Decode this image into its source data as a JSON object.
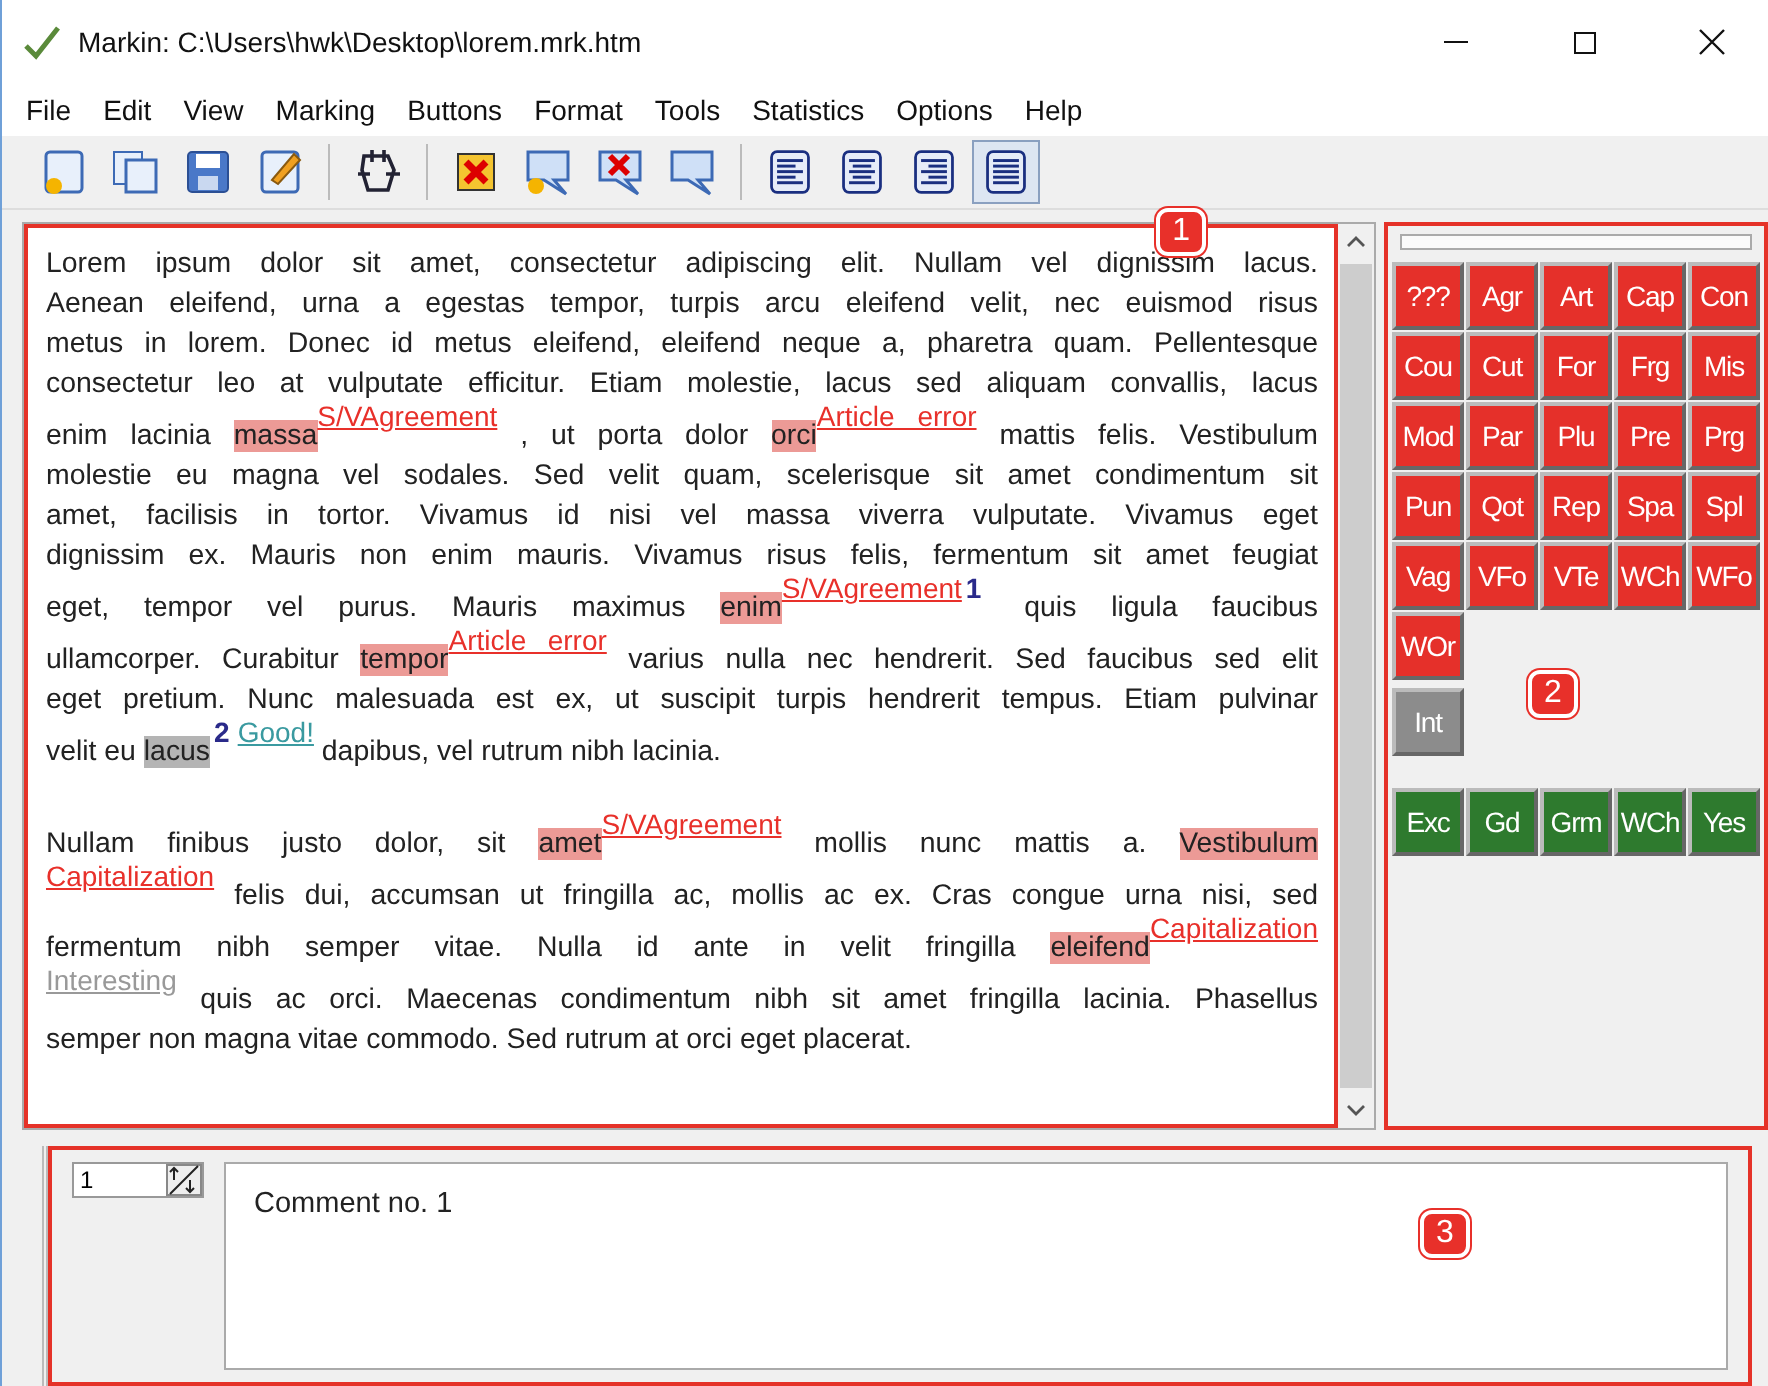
{
  "window": {
    "title": "Markin: C:\\Users\\hwk\\Desktop\\lorem.mrk.htm"
  },
  "menu": [
    "File",
    "Edit",
    "View",
    "Marking",
    "Buttons",
    "Format",
    "Tools",
    "Statistics",
    "Options",
    "Help"
  ],
  "alignment": [
    {
      "kind": "left",
      "selected": false
    },
    {
      "kind": "center",
      "selected": false
    },
    {
      "kind": "right",
      "selected": false
    },
    {
      "kind": "justify",
      "selected": true
    }
  ],
  "document": {
    "callout": "1",
    "paragraphs": [
      [
        [
          {
            "kind": "text",
            "text": "Lorem ipsum dolor sit amet, consectetur adipiscing elit. Nullam vel dignissim lacus."
          }
        ],
        [
          {
            "kind": "text",
            "text": "Aenean eleifend, urna a egestas tempor, turpis arcu eleifend velit, nec euismod risus"
          }
        ],
        [
          {
            "kind": "text",
            "text": "metus in lorem. Donec id metus eleifend, eleifend neque a, pharetra quam. Pellentesque"
          }
        ],
        [
          {
            "kind": "text",
            "text": "consectetur leo at vulputate efficitur. Etiam molestie, lacus sed aliquam convallis, lacus"
          }
        ],
        [
          {
            "kind": "text",
            "text": "enim lacinia "
          },
          {
            "kind": "word",
            "text": "massa",
            "color": "#ec9a96"
          },
          {
            "kind": "label",
            "text": "S/VAgreement",
            "color": "#e8302a"
          },
          {
            "kind": "text",
            "text": " , ut porta dolor "
          },
          {
            "kind": "word",
            "text": "orci",
            "color": "#ec9a96"
          },
          {
            "kind": "label",
            "text": "Article error",
            "color": "#e8302a"
          },
          {
            "kind": "text",
            "text": " mattis felis. Vestibulum"
          }
        ],
        [
          {
            "kind": "text",
            "text": "molestie eu magna vel sodales. Sed velit quam, scelerisque sit amet condimentum sit"
          }
        ],
        [
          {
            "kind": "text",
            "text": "amet, facilisis in tortor. Vivamus id nisi vel massa viverra vulputate. Vivamus eget"
          }
        ],
        [
          {
            "kind": "text",
            "text": "dignissim ex. Mauris non enim mauris. Vivamus risus felis, fermentum sit amet feugiat"
          }
        ],
        [
          {
            "kind": "text",
            "text": "eget, tempor vel purus. Mauris maximus "
          },
          {
            "kind": "word",
            "text": "enim",
            "color": "#ec9a96"
          },
          {
            "kind": "label",
            "text": "S/VAgreement",
            "color": "#e8302a"
          },
          {
            "kind": "number",
            "text": "1"
          },
          {
            "kind": "text",
            "text": " quis ligula faucibus"
          }
        ],
        [
          {
            "kind": "text",
            "text": "ullamcorper. Curabitur "
          },
          {
            "kind": "word",
            "text": "tempor",
            "color": "#ec9a96"
          },
          {
            "kind": "label",
            "text": "Article error",
            "color": "#e8302a"
          },
          {
            "kind": "text",
            "text": " varius nulla nec hendrerit. Sed faucibus sed elit"
          }
        ],
        [
          {
            "kind": "text",
            "text": "eget pretium. Nunc malesuada est ex, ut suscipit turpis hendrerit tempus. Etiam pulvinar"
          }
        ],
        [
          {
            "kind": "text",
            "text": "velit eu "
          },
          {
            "kind": "word",
            "text": "lacus",
            "color": "#b4b4b4"
          },
          {
            "kind": "number",
            "text": "2"
          },
          {
            "kind": "label",
            "text": "Good!",
            "color": "#3a9aa0"
          },
          {
            "kind": "text",
            "text": " dapibus, vel rutrum nibh lacinia."
          }
        ]
      ],
      [
        [
          {
            "kind": "text",
            "text": "Nullam finibus justo dolor, sit "
          },
          {
            "kind": "word",
            "text": "amet",
            "color": "#ec9a96"
          },
          {
            "kind": "label",
            "text": "S/VAgreement",
            "color": "#e8302a"
          },
          {
            "kind": "text",
            "text": " mollis nunc mattis a. "
          },
          {
            "kind": "word",
            "text": "Vestibulum",
            "color": "#ec9a96"
          }
        ],
        [
          {
            "kind": "label",
            "text": "Capitalization",
            "color": "#e8302a"
          },
          {
            "kind": "text",
            "text": " felis dui, accumsan ut fringilla ac, mollis ac ex. Cras congue urna nisi, sed"
          }
        ],
        [
          {
            "kind": "text",
            "text": "fermentum nibh semper vitae. Nulla id ante in velit fringilla "
          },
          {
            "kind": "word",
            "text": "eleifend",
            "color": "#ec9a96"
          },
          {
            "kind": "label",
            "text": "Capitalization",
            "color": "#e8302a"
          }
        ],
        [
          {
            "kind": "label",
            "text": "Interesting",
            "color": "#999999"
          },
          {
            "kind": "text",
            "text": " quis ac orci. Maecenas condimentum nibh sit amet fringilla lacinia. Phasellus"
          }
        ],
        [
          {
            "kind": "text",
            "text": "semper non magna vitae commodo. Sed rutrum at orci eget placerat."
          }
        ]
      ]
    ]
  },
  "button_panel": {
    "callout": "2",
    "groups": [
      {
        "color": "#e5302a",
        "buttons": [
          "???",
          "Agr",
          "Art",
          "Cap",
          "Con",
          "Cou",
          "Cut",
          "For",
          "Frg",
          "Mis",
          "Mod",
          "Par",
          "Plu",
          "Pre",
          "Prg",
          "Pun",
          "Qot",
          "Rep",
          "Spa",
          "Spl",
          "Vag",
          "VFo",
          "VTe",
          "WCh",
          "WFo",
          "WOr"
        ]
      },
      {
        "color": "#8c8c8c",
        "buttons": [
          "Int"
        ]
      },
      {
        "color": "#2e7a2e",
        "buttons": [
          "Exc",
          "Gd",
          "Grm",
          "WCh",
          "Yes"
        ]
      }
    ]
  },
  "comment_panel": {
    "callout": "3",
    "number": "1",
    "comment": "Comment no. 1"
  }
}
